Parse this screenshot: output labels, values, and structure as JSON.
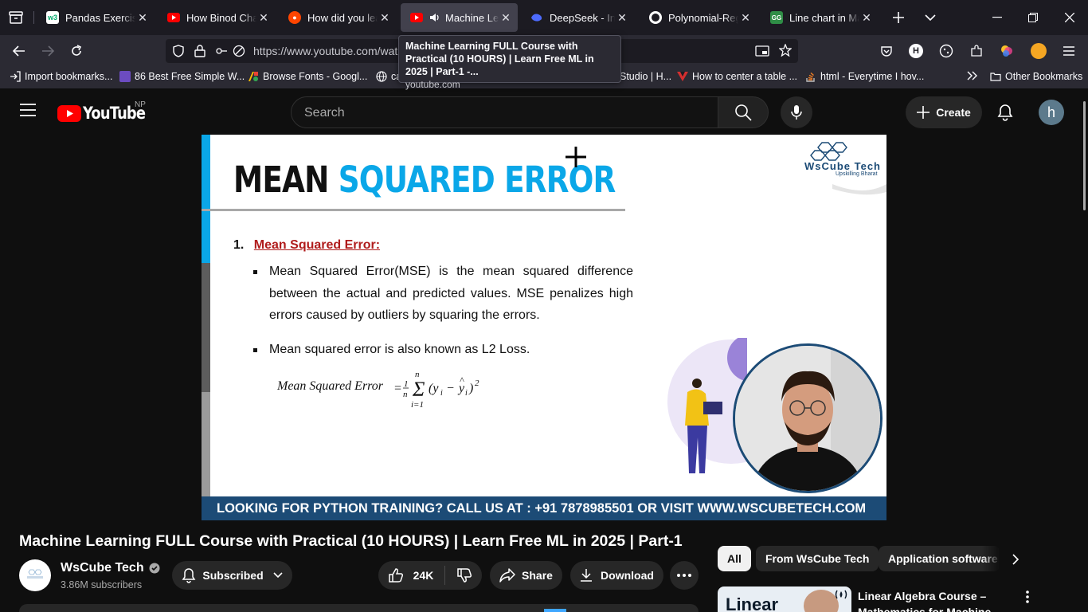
{
  "browser": {
    "tabs": [
      {
        "title": "Pandas Exercises, Pr",
        "favicon": "w3schools"
      },
      {
        "title": "How Binod Chaudha",
        "favicon": "youtube"
      },
      {
        "title": "How did you learn",
        "favicon": "reddit"
      },
      {
        "title": "Machine Learning",
        "favicon": "youtube",
        "active": true,
        "audio": true
      },
      {
        "title": "DeepSeek - Into the",
        "favicon": "deepseek"
      },
      {
        "title": "Polynomial-Regress",
        "favicon": "github"
      },
      {
        "title": "Line chart in Matplo",
        "favicon": "geeksforgeeks"
      }
    ],
    "url": "https://www.youtube.com/wat",
    "tooltip": {
      "title": "Machine Learning FULL Course with Practical (10 HOURS) | Learn Free ML in 2025 | Part-1 -...",
      "domain": "youtube.com"
    },
    "bookmarks": [
      {
        "label": "Import bookmarks..."
      },
      {
        "label": "86 Best Free Simple W..."
      },
      {
        "label": "Browse Fonts - Googl..."
      },
      {
        "label": "ca"
      },
      {
        "label": "Studio | H..."
      },
      {
        "label": "How to center a table ..."
      },
      {
        "label": "html - Everytime I hov..."
      },
      {
        "label": "Other Bookmarks"
      }
    ]
  },
  "youtube": {
    "logo_text": "YouTube",
    "country": "NP",
    "search_placeholder": "Search",
    "create_label": "Create",
    "avatar_letter": "h"
  },
  "slide": {
    "title_part1": "MEAN",
    "title_part2": "SQUARED ERROR",
    "brand": "WsCube Tech",
    "brand_tagline": "Upskilling Bharat",
    "heading_number": "1.",
    "heading": "Mean Squared Error:",
    "bullet1": "Mean Squared Error(MSE) is the mean squared difference between the actual and predicted values. MSE penalizes high errors caused by outliers by squaring the errors.",
    "bullet2": "Mean squared error is also known as L2 Loss.",
    "formula_label": "Mean Squared Error",
    "banner": "LOOKING FOR PYTHON TRAINING? CALL US AT : +91 7878985501 OR VISIT WWW.WSCUBETECH.COM"
  },
  "video": {
    "title": "Machine Learning FULL Course with Practical (10 HOURS) | Learn Free ML in 2025 | Part-1",
    "channel": "WsCube Tech",
    "subscribers": "3.86M subscribers",
    "subscribed_label": "Subscribed",
    "likes": "24K",
    "share_label": "Share",
    "download_label": "Download"
  },
  "sidebar": {
    "chips": [
      "All",
      "From WsCube Tech",
      "Application software"
    ],
    "next_video_title": "Linear Algebra Course – Mathematics for Machine",
    "next_thumb_text": "Linear"
  },
  "colors": {
    "youtube_red": "#ff0000",
    "slide_accent": "#0aa7e8",
    "banner_blue": "#1c4b76",
    "heading_red": "#b01c1c"
  }
}
